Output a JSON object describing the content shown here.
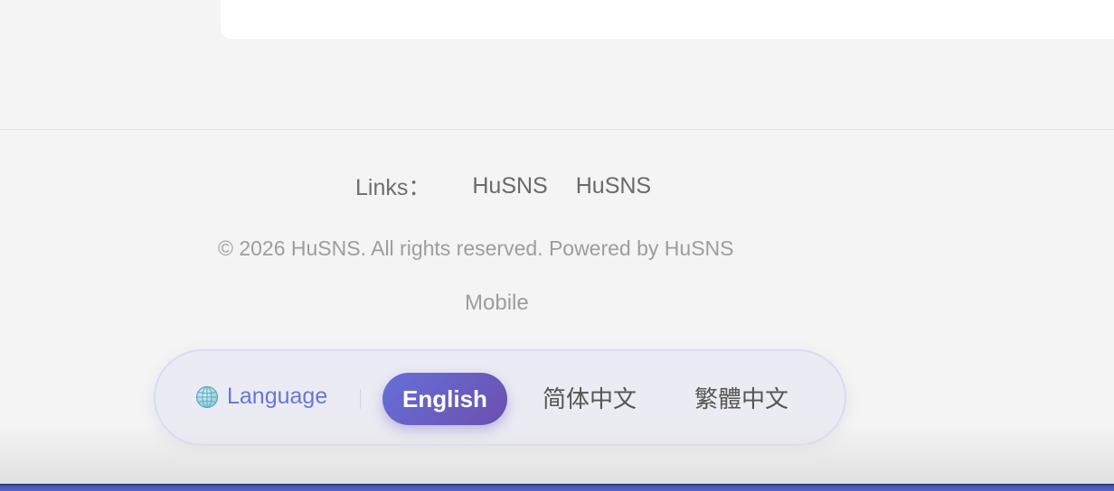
{
  "footer": {
    "links_label": "Links：",
    "links": [
      "HuSNS",
      "HuSNS"
    ],
    "copyright": "© 2026 HuSNS. All rights reserved. Powered by HuSNS",
    "mobile": "Mobile"
  },
  "language": {
    "icon": "globe-icon",
    "label": "Language",
    "options": [
      {
        "label": "English",
        "selected": true
      },
      {
        "label": "简体中文",
        "selected": false
      },
      {
        "label": "繁體中文",
        "selected": false
      }
    ]
  },
  "colors": {
    "accent": "#6676dc",
    "selected_gradient_start": "#6670d9",
    "selected_gradient_end": "#6b4fae"
  }
}
